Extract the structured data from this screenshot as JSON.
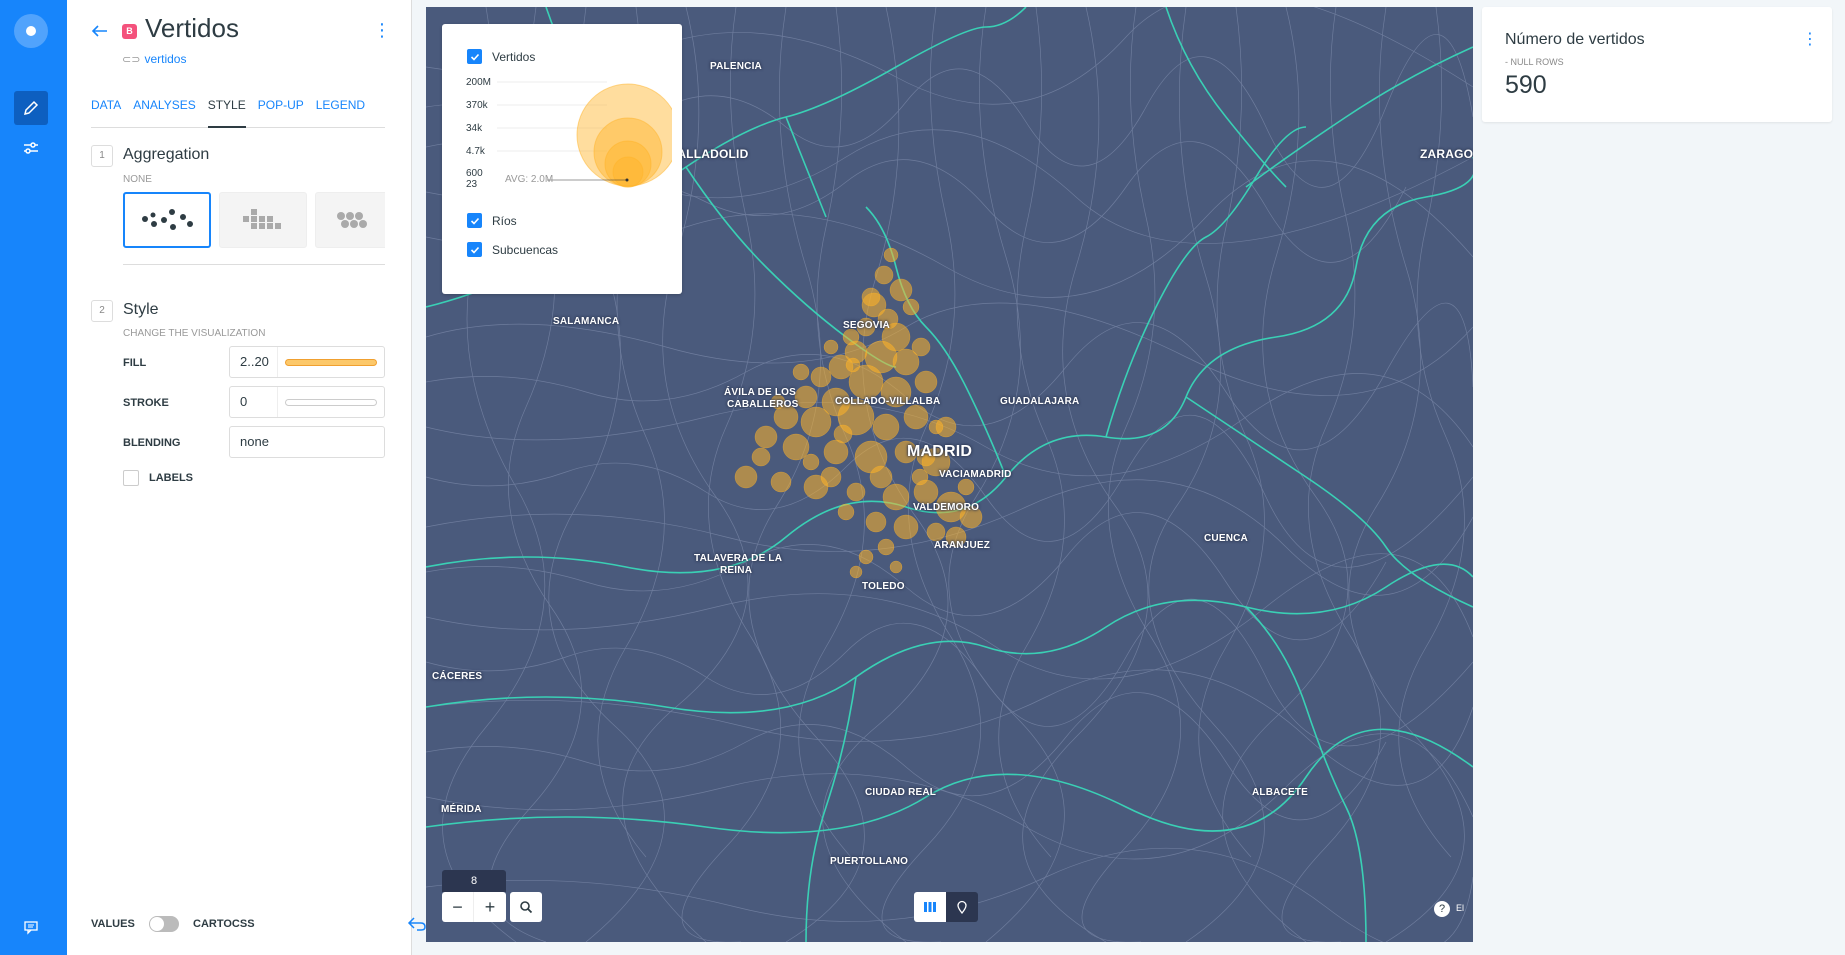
{
  "app": {
    "rail_icons": [
      "logo-icon",
      "pencil-icon",
      "sliders-icon",
      "chat-icon"
    ]
  },
  "editor": {
    "badge": "B",
    "title": "Vertidos",
    "source": "vertidos",
    "tabs": [
      {
        "label": "DATA",
        "active": false
      },
      {
        "label": "ANALYSES",
        "active": false
      },
      {
        "label": "STYLE",
        "active": true
      },
      {
        "label": "POP-UP",
        "active": false
      },
      {
        "label": "LEGEND",
        "active": false
      }
    ],
    "aggregation": {
      "num": "1",
      "title": "Aggregation",
      "subtitle": "NONE"
    },
    "style": {
      "num": "2",
      "title": "Style",
      "subtitle": "CHANGE THE VISUALIZATION",
      "fill_label": "FILL",
      "fill_value": "2..20",
      "stroke_label": "STROKE",
      "stroke_value": "0",
      "blending_label": "BLENDING",
      "blending_value": "none",
      "labels_label": "LABELS"
    },
    "footer": {
      "values_label": "VALUES",
      "cartocss_label": "CARTOCSS"
    }
  },
  "colors": {
    "accent": "#1785fb",
    "map_bg": "#4a5a7c",
    "rivers": "#3ad0b5",
    "bubbles": "#ffb428"
  },
  "map": {
    "zoom": "8",
    "legend": {
      "layers": [
        "Vertidos",
        "Ríos",
        "Subcuencas"
      ],
      "ticks": [
        "200M",
        "370k",
        "34k",
        "4.7k",
        "600",
        "23"
      ],
      "avg": "AVG: 2.0M"
    },
    "cities": [
      {
        "name": "PALENCIA"
      },
      {
        "name": "VALLADOLID"
      },
      {
        "name": "ZARAGO"
      },
      {
        "name": "SALAMANCA"
      },
      {
        "name": "SEGOVIA"
      },
      {
        "name": "ÁVILA DE LOS"
      },
      {
        "name": "CABALLEROS"
      },
      {
        "name": "COLLADO-VILLALBA"
      },
      {
        "name": "GUADALAJARA"
      },
      {
        "name": "MADRID"
      },
      {
        "name": "VACIAMADRID"
      },
      {
        "name": "VALDEMORO"
      },
      {
        "name": "ARANJUEZ"
      },
      {
        "name": "TALAVERA DE LA"
      },
      {
        "name": "REINA"
      },
      {
        "name": "TOLEDO"
      },
      {
        "name": "CUENCA"
      },
      {
        "name": "CÁCERES"
      },
      {
        "name": "CIUDAD REAL"
      },
      {
        "name": "MÉRIDA"
      },
      {
        "name": "ALBACETE"
      },
      {
        "name": "PUERTOLLANO"
      }
    ],
    "help": "?",
    "attribution": "El"
  },
  "widget": {
    "title": "Número de vertidos",
    "subtitle": "- NULL ROWS",
    "value": "590"
  }
}
